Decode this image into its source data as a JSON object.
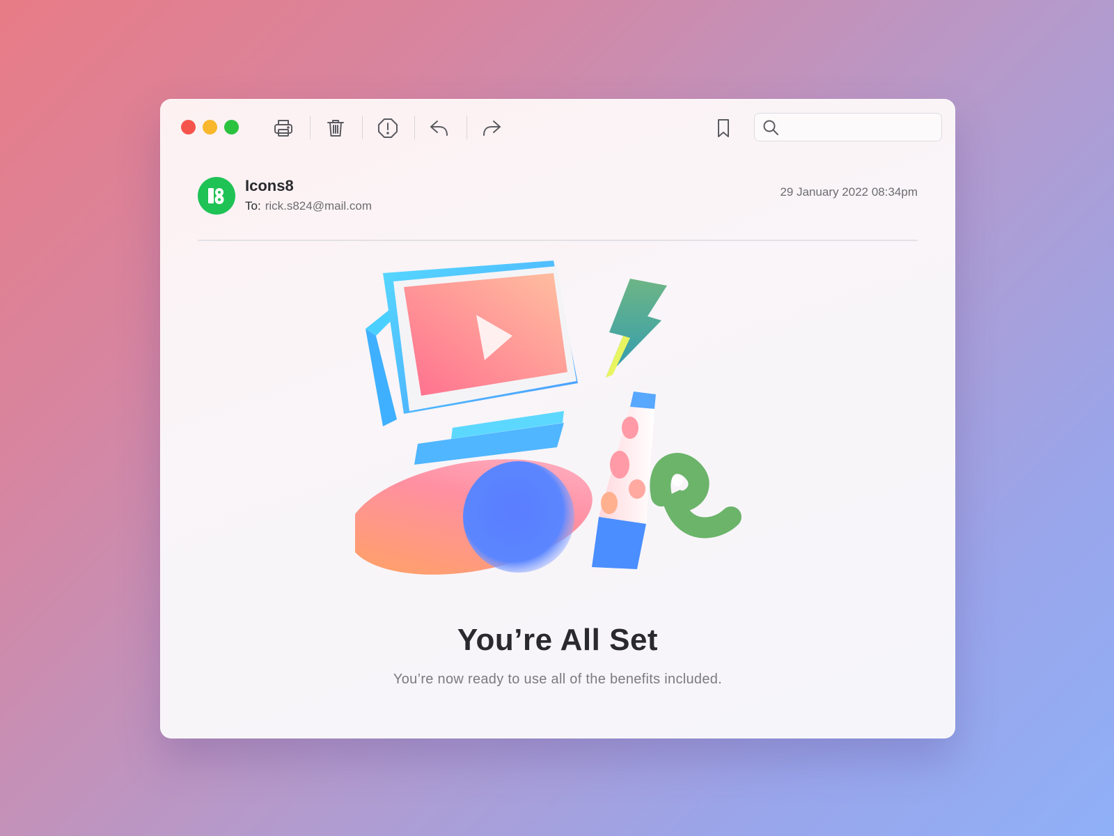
{
  "toolbar": {
    "icons": [
      "printer-icon",
      "trash-icon",
      "report-junk-icon",
      "reply-icon",
      "forward-icon",
      "bookmark-icon",
      "search-icon"
    ],
    "search_placeholder": ""
  },
  "email": {
    "sender": "Icons8",
    "to_label": "To:",
    "to_address": "rick.s824@mail.com",
    "date": "29 January 2022 08:34pm",
    "title": "You’re All Set",
    "subtitle": "You’re now ready to use all of the benefits included."
  },
  "colors": {
    "close": "#f5544d",
    "minimize": "#f8b72c",
    "zoom": "#2bc23f",
    "avatar": "#1fc255"
  }
}
